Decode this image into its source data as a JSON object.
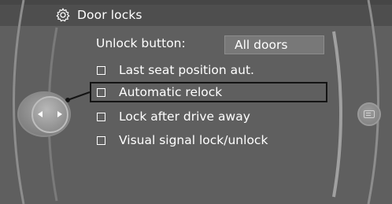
{
  "header": {
    "title": "Door locks",
    "icon": "settings-gear-icon"
  },
  "settings": {
    "unlock_button": {
      "label": "Unlock button:",
      "value": "All doors"
    },
    "options": [
      {
        "label": "Last seat position aut.",
        "checked": false,
        "selected": false
      },
      {
        "label": "Automatic relock",
        "checked": false,
        "selected": true
      },
      {
        "label": "Lock after drive away",
        "checked": false,
        "selected": false
      },
      {
        "label": "Visual signal lock/unlock",
        "checked": false,
        "selected": false
      }
    ]
  },
  "controls": {
    "controller_icon": "controller-left-right-icon",
    "side_icon": "options-menu-icon"
  },
  "colors": {
    "screen_background": "#5f5f5f",
    "header_background": "#4e4e4e",
    "value_field": "#787878",
    "text": "#ffffff",
    "selection_frame": "#141414"
  }
}
